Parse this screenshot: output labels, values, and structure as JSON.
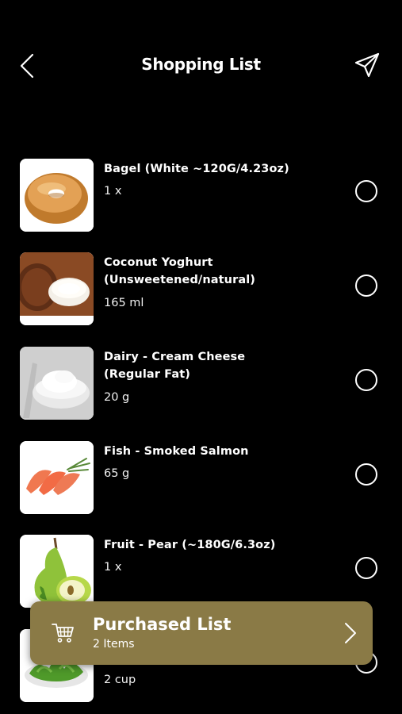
{
  "header": {
    "title": "Shopping List",
    "back_icon": "chevron-left-icon",
    "send_icon": "paper-plane-icon"
  },
  "items": [
    {
      "name": "Bagel (White ~120G/4.23oz)",
      "quantity": "1 x",
      "image": "bagel"
    },
    {
      "name": "Coconut Yoghurt (Unsweetened/natural)",
      "quantity": "165 ml",
      "image": "coconut-yoghurt"
    },
    {
      "name": "Dairy - Cream Cheese (Regular Fat)",
      "quantity": "20 g",
      "image": "cream-cheese"
    },
    {
      "name": "Fish - Smoked Salmon",
      "quantity": "65 g",
      "image": "smoked-salmon"
    },
    {
      "name": "Fruit - Pear (~180G/6.3oz)",
      "quantity": "1 x",
      "image": "pear"
    },
    {
      "name": "",
      "quantity": "2 cup",
      "image": "salad-greens"
    }
  ],
  "purchased_list": {
    "title": "Purchased List",
    "subtitle": "2 Items",
    "icon": "cart-icon",
    "bar_color": "#8a7a46"
  }
}
